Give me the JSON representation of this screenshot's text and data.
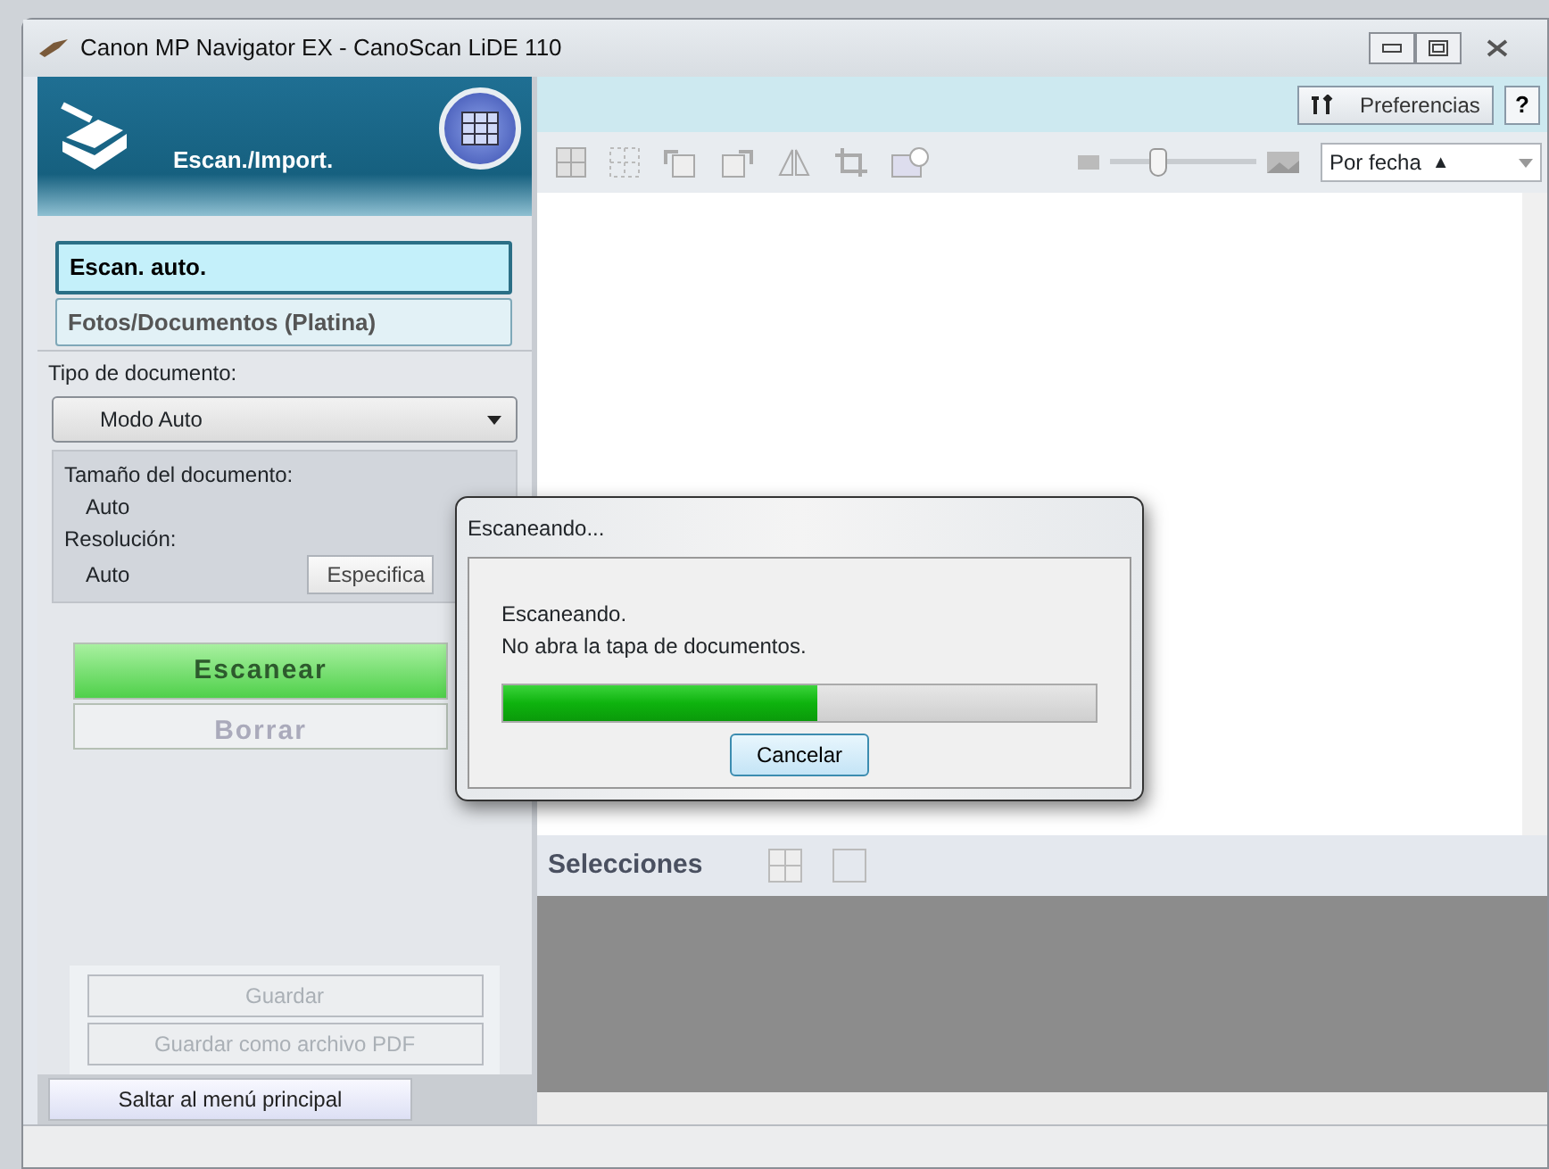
{
  "window": {
    "title": "Canon MP Navigator EX - CanoScan LiDE 110"
  },
  "sidebar": {
    "header": "Escan./Import.",
    "modes": [
      {
        "label": "Escan. auto.",
        "selected": true
      },
      {
        "label": "Fotos/Documentos (Platina)",
        "selected": false
      }
    ],
    "document_type": {
      "label": "Tipo de documento:",
      "value": "Modo Auto"
    },
    "settings": [
      {
        "label": "Tamaño del documento:",
        "value": "Auto"
      },
      {
        "label": "Resolución:",
        "value": "Auto"
      }
    ],
    "specify_button": "Especifica",
    "actions": [
      {
        "label": "Escanear",
        "disabled": false
      },
      {
        "label": "Borrar",
        "disabled": true
      }
    ],
    "save_actions": [
      {
        "label": "Guardar",
        "disabled": true
      },
      {
        "label": "Guardar como archivo PDF",
        "disabled": true
      }
    ],
    "main_menu_button": "Saltar al menú principal"
  },
  "top_bar": {
    "preferences": "Preferencias",
    "help": "?"
  },
  "toolbar": {
    "zoom": {
      "level": 0.3
    },
    "sort": {
      "label": "Por fecha",
      "arrow": "▲"
    }
  },
  "selections": {
    "title": "Selecciones"
  },
  "dialog": {
    "title": "Escaneando...",
    "message": [
      "Escaneando.",
      "No abra la tapa de documentos."
    ],
    "progress": {
      "level": 0.53
    },
    "button": "Cancelar"
  }
}
